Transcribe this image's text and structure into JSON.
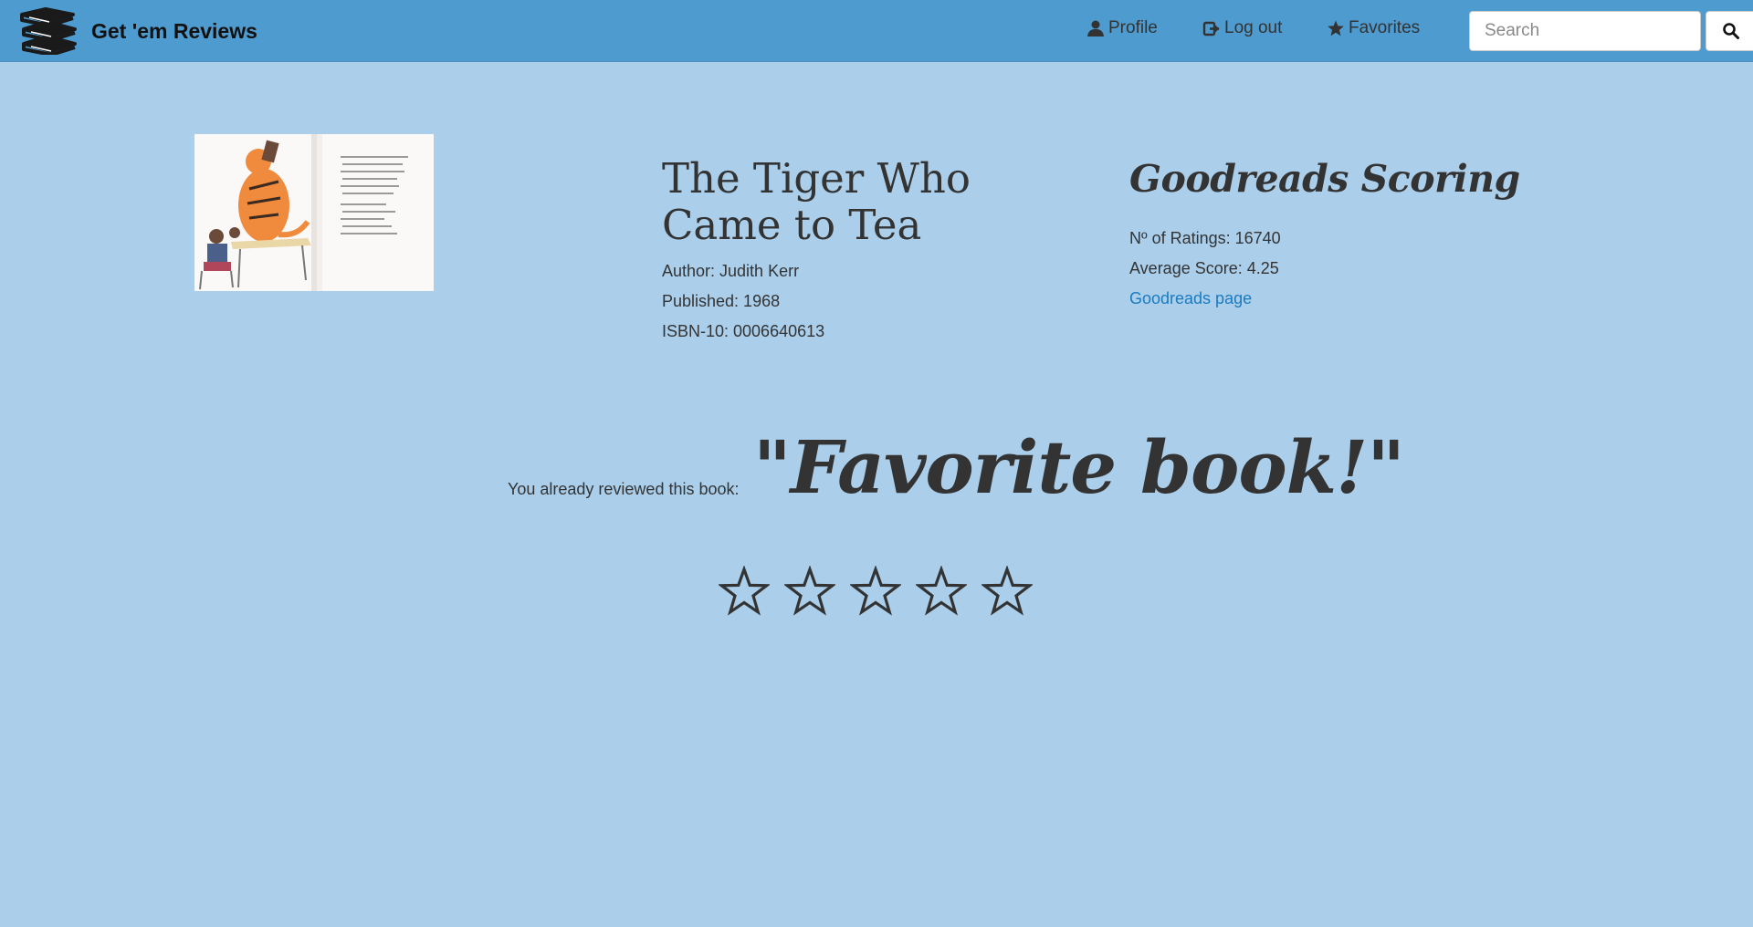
{
  "navbar": {
    "brand_title": "Get 'em Reviews",
    "brand_icon": "books-stack-icon",
    "links": [
      {
        "label": "Profile",
        "icon": "user-icon"
      },
      {
        "label": "Log out",
        "icon": "log-out-icon"
      },
      {
        "label": "Favorites",
        "icon": "star-icon"
      }
    ],
    "search": {
      "placeholder": "Search",
      "value": ""
    },
    "search_button_icon": "search-icon"
  },
  "book": {
    "title": "The Tiger Who Came to Tea",
    "author": "Author: Judith Kerr",
    "published": "Published: 1968",
    "isbn": "ISBN-10: 0006640613"
  },
  "goodreads": {
    "heading": "Goodreads Scoring",
    "ratings": "Nº of Ratings: 16740",
    "average": "Average Score: 4.25",
    "link_label": "Goodreads page"
  },
  "review": {
    "label": "You already reviewed this book:",
    "text": "\"Favorite book!\""
  },
  "rating": {
    "stars_total": 5,
    "stars_filled": 0
  },
  "colors": {
    "page_background": "#abcfeb",
    "navbar_background": "#4e9bcf",
    "link": "#1a7bbf",
    "text": "#333333"
  }
}
